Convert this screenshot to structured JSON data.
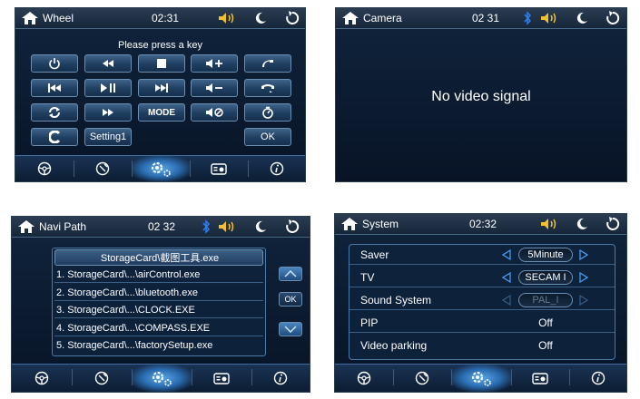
{
  "colors": {
    "accent": "#2b6fb3",
    "panel_bg": "#0b1a2f",
    "bar_top": "#2b3d52",
    "bt_blue": "#2e7ff0",
    "vol_yellow": "#f0c030",
    "text": "#ffffff"
  },
  "wheel": {
    "title": "Wheel",
    "time": "02:31",
    "prompt": "Please press a key",
    "keys": {
      "mode": "MODE",
      "setting": "Setting1",
      "ok": "OK"
    }
  },
  "camera": {
    "title": "Camera",
    "time": "02 31",
    "message": "No video signal"
  },
  "navi": {
    "title": "Navi Path",
    "time": "02 32",
    "header": "StorageCard\\截图工具.exe",
    "items": [
      "1. StorageCard\\...\\airControl.exe",
      "2. StorageCard\\...\\bluetooth.exe",
      "3. StorageCard\\...\\CLOCK.EXE",
      "4. StorageCard\\...\\COMPASS.EXE",
      "5. StorageCard\\...\\factorySetup.exe"
    ],
    "ok": "OK"
  },
  "system": {
    "title": "System",
    "time": "02:32",
    "rows": [
      {
        "label": "Saver",
        "value": "5Minute"
      },
      {
        "label": "TV",
        "value": "SECAM I"
      },
      {
        "label": "Sound System",
        "value": "PAL_I"
      },
      {
        "label": "PIP",
        "value": "Off"
      },
      {
        "label": "Video parking",
        "value": "Off"
      }
    ]
  },
  "icons": [
    "home-icon",
    "volume-icon",
    "moon-icon",
    "back-icon",
    "bluetooth-icon",
    "power-icon",
    "rewind-icon",
    "stop-icon",
    "volume-up-icon",
    "phone-answer-icon",
    "prev-track-icon",
    "play-pause-icon",
    "next-track-icon",
    "volume-down-icon",
    "phone-hangup-icon",
    "loop-icon",
    "fast-forward-icon",
    "mute-icon",
    "timer-icon",
    "clear-icon",
    "steering-wheel-icon",
    "compass-icon",
    "settings-gear-icon",
    "radio-icon",
    "info-icon",
    "scroll-up-icon",
    "scroll-down-icon"
  ]
}
